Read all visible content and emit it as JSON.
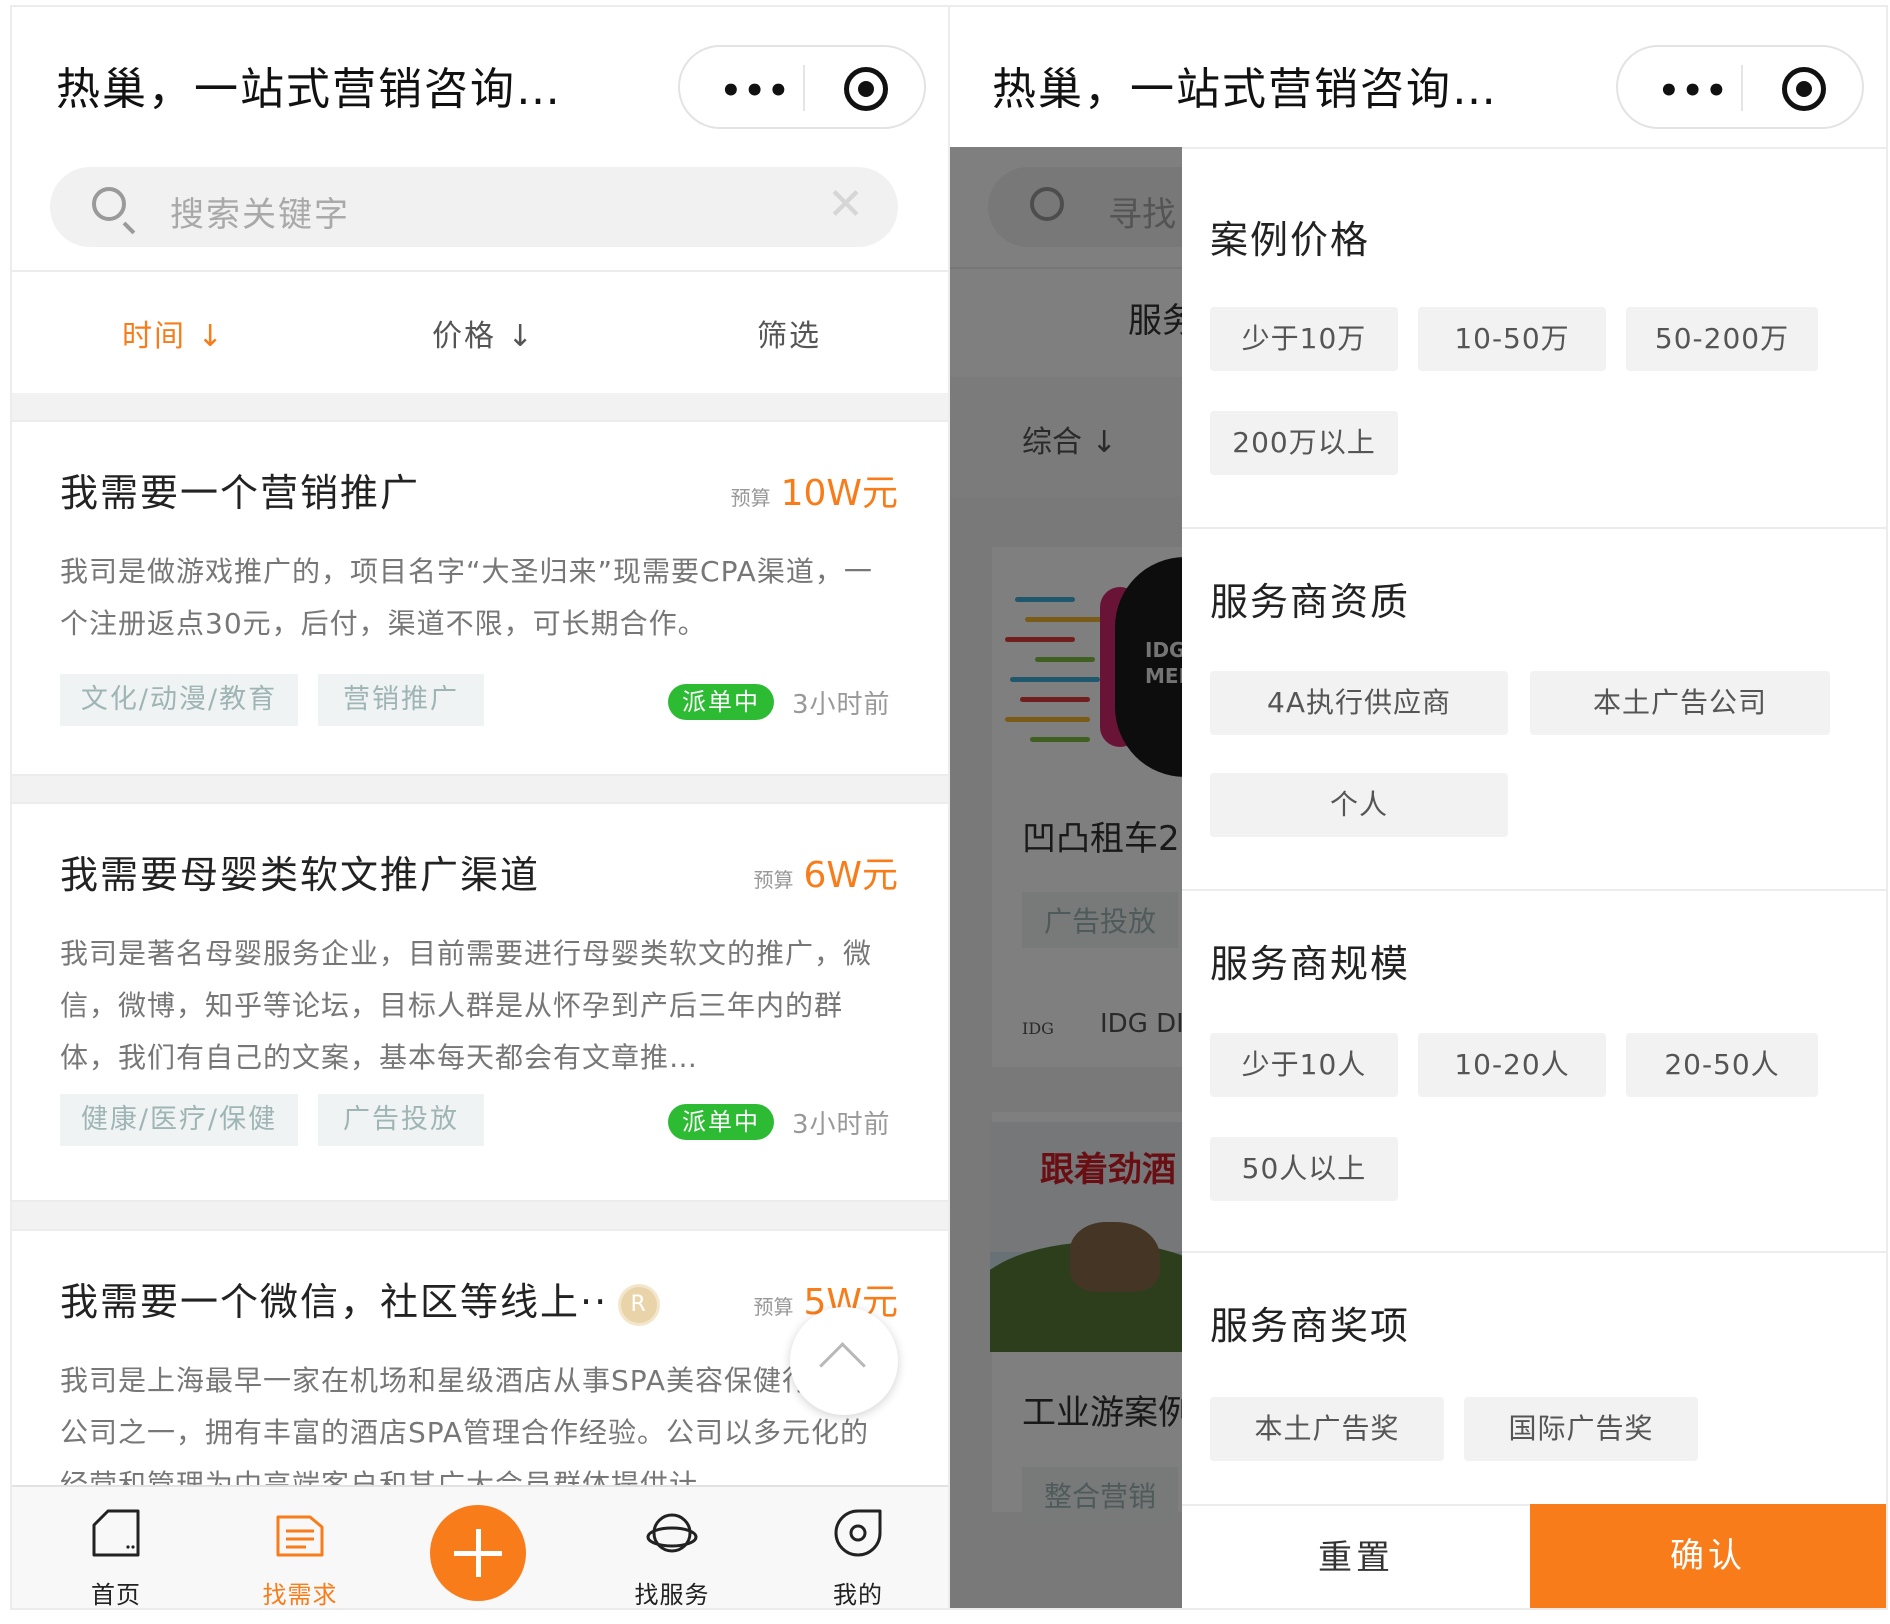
{
  "left": {
    "title": "热巢，一站式营销咨询…",
    "capsule": {
      "more": "•••"
    },
    "search": {
      "placeholder": "搜索关键字",
      "clear": "✕"
    },
    "sort": {
      "time": "时间 ↓",
      "price": "价格 ↓",
      "filter": "筛选"
    },
    "budget_label": "预算",
    "cards": [
      {
        "title": "我需要一个营销推广",
        "budget": "10W元",
        "desc": "我司是做游戏推广的，项目名字“大圣归来”现需要CPA渠道，一个注册返点30元，后付，渠道不限，可长期合作。",
        "tags": [
          "文化/动漫/教育",
          "营销推广"
        ],
        "status": "派单中",
        "time": "3小时前"
      },
      {
        "title": "我需要母婴类软文推广渠道",
        "budget": "6W元",
        "desc": "我司是著名母婴服务企业，目前需要进行母婴类软文的推广，微信，微博，知乎等论坛，目标人群是从怀孕到产后三年内的群体，我们有自己的文案，基本每天都会有文章推…",
        "tags": [
          "健康/医疗/保健",
          "广告投放"
        ],
        "status": "派单中",
        "time": "3小时前"
      },
      {
        "title": "我需要一个微信，社区等线上··",
        "avatar": "R",
        "budget": "5W元",
        "desc": "我司是上海最早一家在机场和星级酒店从事SPA美容保健行业的公司之一，拥有丰富的酒店SPA管理合作经验。公司以多元化的经营和管理为中高端客户和其广大会员群体提供计…"
      }
    ],
    "tabbar": {
      "home": "首页",
      "demand": "找需求",
      "service": "找服务",
      "mine": "我的"
    }
  },
  "right": {
    "title": "热巢，一站式营销咨询…",
    "capsule": {
      "more": "•••"
    },
    "background": {
      "search_placeholder": "寻找",
      "tab_service": "服务",
      "sort_general": "综合 ↓",
      "case1_title": "凹凸租车2",
      "case1_tag": "广告投放",
      "case1_brand": "IDG DI",
      "case1_logo": "IDG",
      "case1_image_text": "IDG MED",
      "case2_title": "工业游案例",
      "case2_tag": "整合营销",
      "case2_image_text": "跟着劲酒"
    },
    "filter": {
      "sections": [
        {
          "title": "案例价格",
          "options": [
            "少于10万",
            "10-50万",
            "50-200万",
            "200万以上"
          ]
        },
        {
          "title": "服务商资质",
          "options": [
            "4A执行供应商",
            "本土广告公司",
            "个人"
          ]
        },
        {
          "title": "服务商规模",
          "options": [
            "少于10人",
            "10-20人",
            "20-50人",
            "50人以上"
          ]
        },
        {
          "title": "服务商奖项",
          "options": [
            "本土广告奖",
            "国际广告奖"
          ]
        }
      ],
      "reset": "重置",
      "confirm": "确认"
    }
  },
  "colors": {
    "accent": "#f87d1a",
    "badge": "#2dbb34",
    "tag_text": "#9fb5b5"
  }
}
